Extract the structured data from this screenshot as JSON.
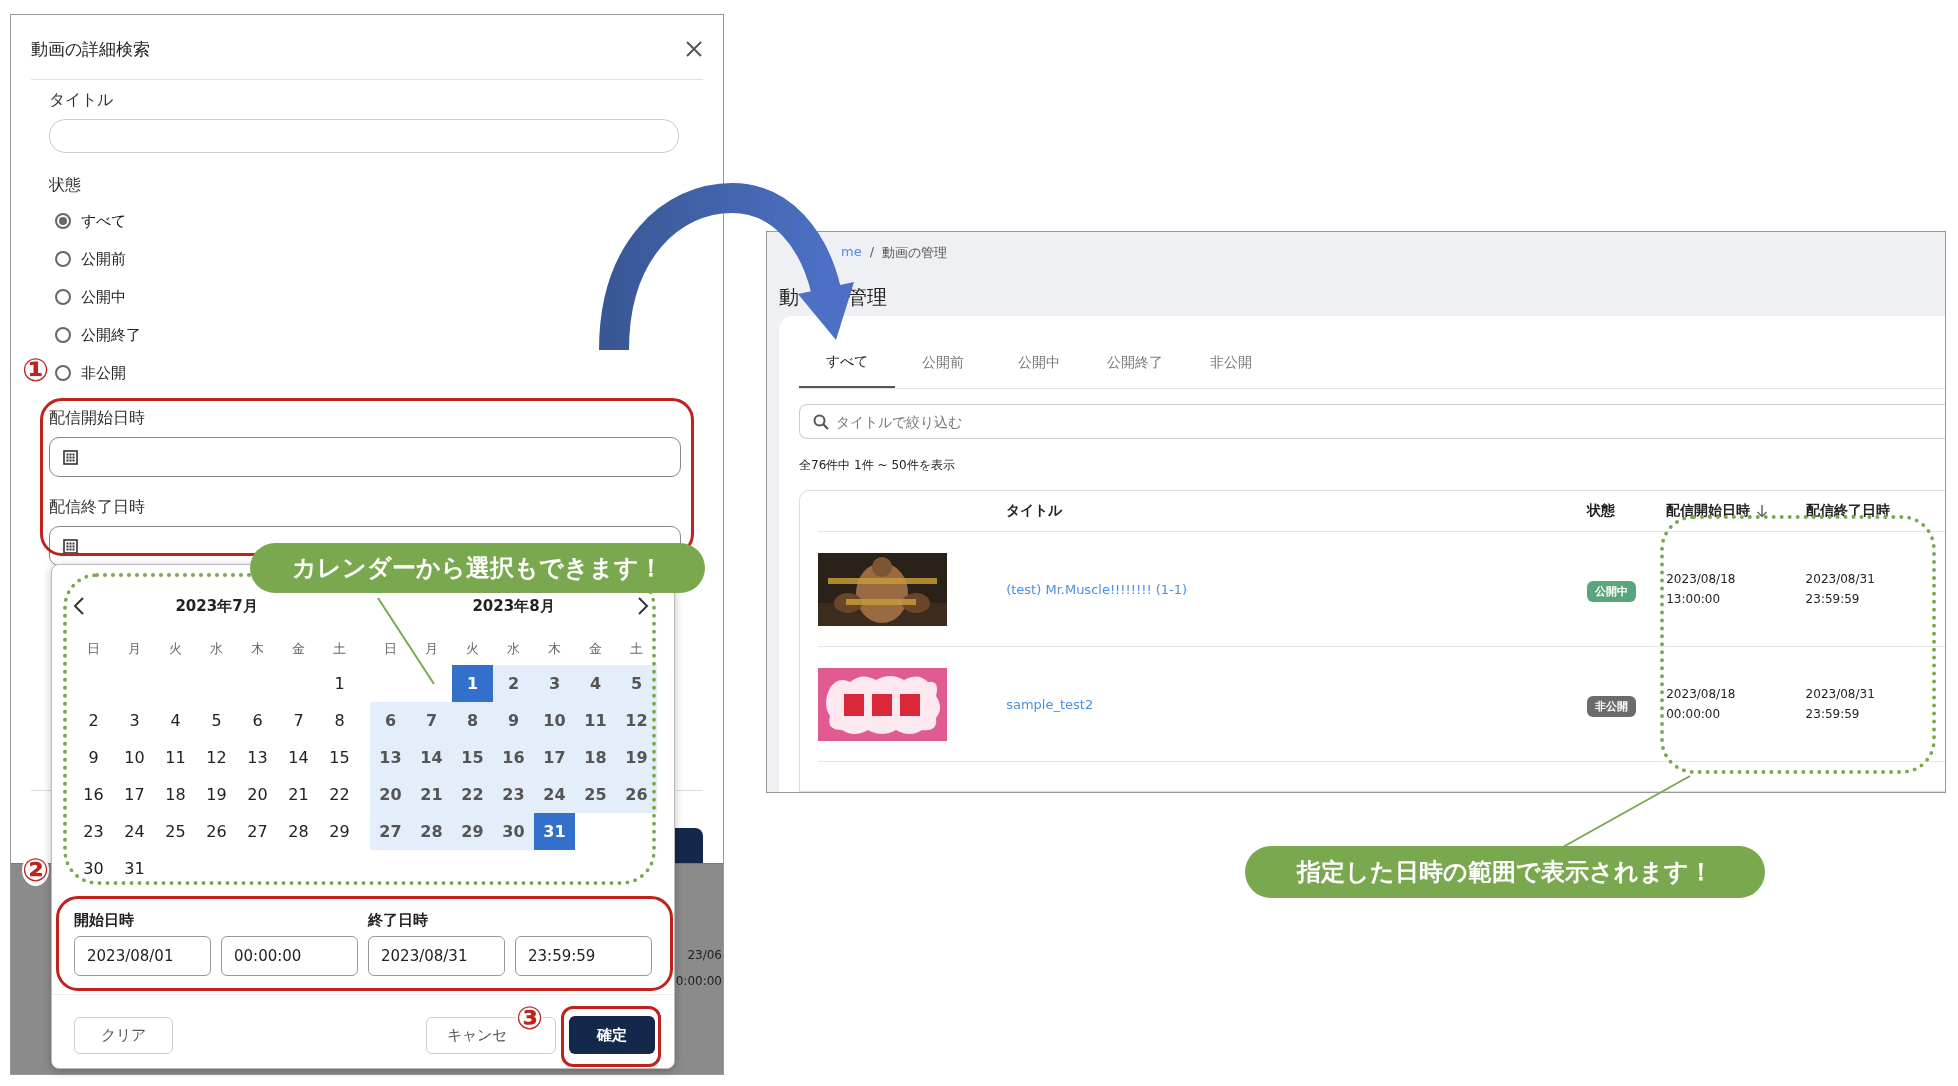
{
  "search_dialog": {
    "title": "動画の詳細検索",
    "title_label": "タイトル",
    "status_label": "状態",
    "status_options": [
      {
        "label": "すべて",
        "selected": true
      },
      {
        "label": "公開前",
        "selected": false
      },
      {
        "label": "公開中",
        "selected": false
      },
      {
        "label": "公開終了",
        "selected": false
      },
      {
        "label": "非公開",
        "selected": false
      }
    ],
    "start_label": "配信開始日時",
    "end_label": "配信終了日時",
    "background_texts": [
      "23/06",
      "0:00:00"
    ]
  },
  "calendar": {
    "months": [
      {
        "title": "2023年7月",
        "weekdays": [
          "日",
          "月",
          "火",
          "水",
          "木",
          "金",
          "土"
        ],
        "weeks": [
          [
            {
              "label": "1",
              "in_range": false,
              "selected": false
            }
          ],
          [
            {
              "label": "2",
              "in_range": false,
              "selected": false
            },
            {
              "label": "3",
              "in_range": false,
              "selected": false
            },
            {
              "label": "4",
              "in_range": false,
              "selected": false
            },
            {
              "label": "5",
              "in_range": false,
              "selected": false
            },
            {
              "label": "6",
              "in_range": false,
              "selected": false
            },
            {
              "label": "7",
              "in_range": false,
              "selected": false
            },
            {
              "label": "8",
              "in_range": false,
              "selected": false
            }
          ],
          [
            {
              "label": "9",
              "in_range": false,
              "selected": false
            },
            {
              "label": "10",
              "in_range": false,
              "selected": false
            },
            {
              "label": "11",
              "in_range": false,
              "selected": false
            },
            {
              "label": "12",
              "in_range": false,
              "selected": false
            },
            {
              "label": "13",
              "in_range": false,
              "selected": false
            },
            {
              "label": "14",
              "in_range": false,
              "selected": false
            },
            {
              "label": "15",
              "in_range": false,
              "selected": false
            }
          ],
          [
            {
              "label": "16",
              "in_range": false,
              "selected": false
            },
            {
              "label": "17",
              "in_range": false,
              "selected": false
            },
            {
              "label": "18",
              "in_range": false,
              "selected": false
            },
            {
              "label": "19",
              "in_range": false,
              "selected": false
            },
            {
              "label": "20",
              "in_range": false,
              "selected": false
            },
            {
              "label": "21",
              "in_range": false,
              "selected": false
            },
            {
              "label": "22",
              "in_range": false,
              "selected": false
            }
          ],
          [
            {
              "label": "23",
              "in_range": false,
              "selected": false
            },
            {
              "label": "24",
              "in_range": false,
              "selected": false
            },
            {
              "label": "25",
              "in_range": false,
              "selected": false
            },
            {
              "label": "26",
              "in_range": false,
              "selected": false
            },
            {
              "label": "27",
              "in_range": false,
              "selected": false
            },
            {
              "label": "28",
              "in_range": false,
              "selected": false
            },
            {
              "label": "29",
              "in_range": false,
              "selected": false
            }
          ],
          [
            {
              "label": "30",
              "in_range": false,
              "selected": false
            },
            {
              "label": "31",
              "in_range": false,
              "selected": false
            }
          ]
        ]
      },
      {
        "title": "2023年8月",
        "weekdays": [
          "日",
          "月",
          "火",
          "水",
          "木",
          "金",
          "土"
        ],
        "weeks": [
          [
            {
              "label": "1",
              "in_range": true,
              "selected": true
            },
            {
              "label": "2",
              "in_range": true,
              "selected": false
            },
            {
              "label": "3",
              "in_range": true,
              "selected": false
            },
            {
              "label": "4",
              "in_range": true,
              "selected": false
            },
            {
              "label": "5",
              "in_range": true,
              "selected": false
            }
          ],
          [
            {
              "label": "6",
              "in_range": true,
              "selected": false
            },
            {
              "label": "7",
              "in_range": true,
              "selected": false
            },
            {
              "label": "8",
              "in_range": true,
              "selected": false
            },
            {
              "label": "9",
              "in_range": true,
              "selected": false
            },
            {
              "label": "10",
              "in_range": true,
              "selected": false
            },
            {
              "label": "11",
              "in_range": true,
              "selected": false
            },
            {
              "label": "12",
              "in_range": true,
              "selected": false
            }
          ],
          [
            {
              "label": "13",
              "in_range": true,
              "selected": false
            },
            {
              "label": "14",
              "in_range": true,
              "selected": false
            },
            {
              "label": "15",
              "in_range": true,
              "selected": false
            },
            {
              "label": "16",
              "in_range": true,
              "selected": false
            },
            {
              "label": "17",
              "in_range": true,
              "selected": false
            },
            {
              "label": "18",
              "in_range": true,
              "selected": false
            },
            {
              "label": "19",
              "in_range": true,
              "selected": false
            }
          ],
          [
            {
              "label": "20",
              "in_range": true,
              "selected": false
            },
            {
              "label": "21",
              "in_range": true,
              "selected": false
            },
            {
              "label": "22",
              "in_range": true,
              "selected": false
            },
            {
              "label": "23",
              "in_range": true,
              "selected": false
            },
            {
              "label": "24",
              "in_range": true,
              "selected": false
            },
            {
              "label": "25",
              "in_range": true,
              "selected": false
            },
            {
              "label": "26",
              "in_range": true,
              "selected": false
            }
          ],
          [
            {
              "label": "27",
              "in_range": true,
              "selected": false
            },
            {
              "label": "28",
              "in_range": true,
              "selected": false
            },
            {
              "label": "29",
              "in_range": true,
              "selected": false
            },
            {
              "label": "30",
              "in_range": true,
              "selected": false
            },
            {
              "label": "31",
              "in_range": true,
              "selected": true
            }
          ]
        ]
      }
    ],
    "start_label": "開始日時",
    "start_date": "2023/08/01",
    "start_time": "00:00:00",
    "end_label": "終了日時",
    "end_date": "2023/08/31",
    "end_time": "23:59:59",
    "buttons": [
      {
        "label": "クリア",
        "kind": "secondary"
      },
      {
        "label": "キャンセ",
        "kind": "secondary"
      },
      {
        "label": "確定",
        "kind": "primary"
      }
    ]
  },
  "step_markers": [
    "①",
    "②",
    "③"
  ],
  "callouts": [
    "カレンダーから選択もできます！",
    "指定した日時の範囲で表示されます！"
  ],
  "video_list": {
    "breadcrumb": [
      "me",
      "/",
      "動画の管理"
    ],
    "heading_parts": [
      "動",
      "管理"
    ],
    "tabs": [
      {
        "label": "すべて",
        "selected": true
      },
      {
        "label": "公開前",
        "selected": false
      },
      {
        "label": "公開中",
        "selected": false
      },
      {
        "label": "公開終了",
        "selected": false
      },
      {
        "label": "非公開",
        "selected": false
      }
    ],
    "search": {
      "placeholder": "タイトルで絞り込む"
    },
    "count_text": "全76件中 1件 ~ 50件を表示",
    "table": {
      "columns": [
        "タイトル",
        "状態",
        "配信開始日時",
        "配信終了日時"
      ],
      "rows": [
        {
          "thumbnail": {
            "kind": "picture"
          },
          "title": "(test) Mr.Muscle!!!!!!!! (1-1)",
          "status": "公開中",
          "color": "#5ba57e",
          "start": [
            "2023/08/18",
            "13:00:00"
          ],
          "end": [
            "2023/08/31",
            "23:59:59"
          ]
        },
        {
          "thumbnail": {
            "kind": "picture"
          },
          "title": "sample_test2",
          "status": "非公開",
          "color": "#6b6b6b",
          "start": [
            "2023/08/18",
            "00:00:00"
          ],
          "end": [
            "2023/08/31",
            "23:59:59"
          ]
        }
      ]
    }
  }
}
